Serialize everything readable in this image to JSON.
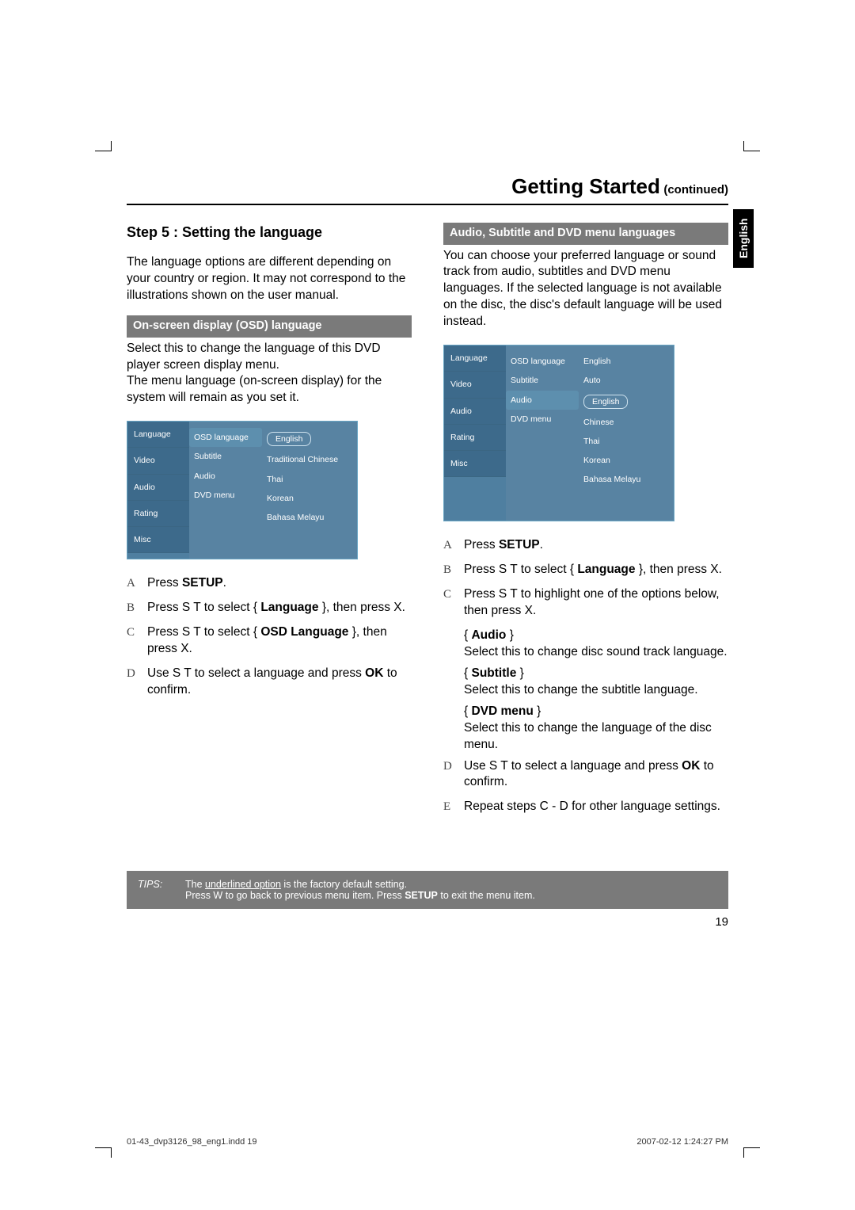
{
  "header": {
    "title": "Getting Started",
    "continued": "(continued)"
  },
  "side_tab": "English",
  "left": {
    "step_heading": "Step 5 :  Setting the language",
    "intro": "The language options are different depending on your country or region. It may not correspond to the illustrations shown on the user manual.",
    "bar": "On-screen display (OSD) language",
    "after_bar": "Select this to change the language of this DVD player screen display menu.\nThe menu language (on-screen display) for the system will remain as you set it.",
    "osd": {
      "sidebar": [
        "Language",
        "Video",
        "Audio",
        "Rating",
        "Misc"
      ],
      "mid": [
        "OSD language",
        "Subtitle",
        "Audio",
        "DVD menu"
      ],
      "mid_selected": "OSD language",
      "right": [
        "English",
        "Traditional Chinese",
        "Thai",
        "Korean",
        "Bahasa Melayu"
      ],
      "right_pill": "English"
    },
    "steps": [
      {
        "k": "A",
        "html": "Press <b>SETUP</b>."
      },
      {
        "k": "B",
        "html": "Press  S  T to select { <b>Language</b> }, then press  X."
      },
      {
        "k": "C",
        "html": "Press  S  T to select { <b>OSD Language</b> }, then press  X."
      },
      {
        "k": "D",
        "html": "Use  S  T to select a language and press <b>OK</b> to confirm."
      }
    ]
  },
  "right": {
    "bar": "Audio, Subtitle and DVD menu languages",
    "intro": "You can choose your preferred language or sound track from audio, subtitles and DVD menu languages. If the selected language is not available on the disc, the disc's default language will be used instead.",
    "osd": {
      "sidebar": [
        "Language",
        "Video",
        "Audio",
        "Rating",
        "Misc"
      ],
      "mid": [
        "OSD language",
        "Subtitle",
        "Audio",
        "DVD menu"
      ],
      "mid_selected": "Audio",
      "right": [
        "English",
        "Auto",
        "English",
        "Chinese",
        "Thai",
        "Korean",
        "Bahasa Melayu"
      ],
      "right_pill_index": 2
    },
    "steps_top": [
      {
        "k": "A",
        "html": "Press <b>SETUP</b>."
      },
      {
        "k": "B",
        "html": "Press  S  T to select { <b>Language</b> }, then press  X."
      },
      {
        "k": "C",
        "html": "Press  S  T to highlight one of the options below, then press  X."
      }
    ],
    "options": [
      {
        "name": "Audio",
        "desc": "Select this to change disc sound track language."
      },
      {
        "name": "Subtitle",
        "desc": "Select this to change the subtitle language."
      },
      {
        "name": "DVD menu",
        "desc": "Select this to change the language of the disc menu."
      }
    ],
    "steps_bottom": [
      {
        "k": "D",
        "html": "Use  S  T to select a language and press <b>OK</b> to confirm."
      },
      {
        "k": "E",
        "html": "Repeat steps C - D for other language settings."
      }
    ]
  },
  "tips": {
    "label": "TIPS:",
    "line1_pre": "The ",
    "line1_u": "underlined option",
    "line1_post": " is the factory default setting.",
    "line2": "Press  W to go back to previous menu item. Press <b>SETUP</b> to exit the menu item."
  },
  "page_number": "19",
  "footer_left": "01-43_dvp3126_98_eng1.indd   19",
  "footer_right": "2007-02-12   1:24:27 PM"
}
